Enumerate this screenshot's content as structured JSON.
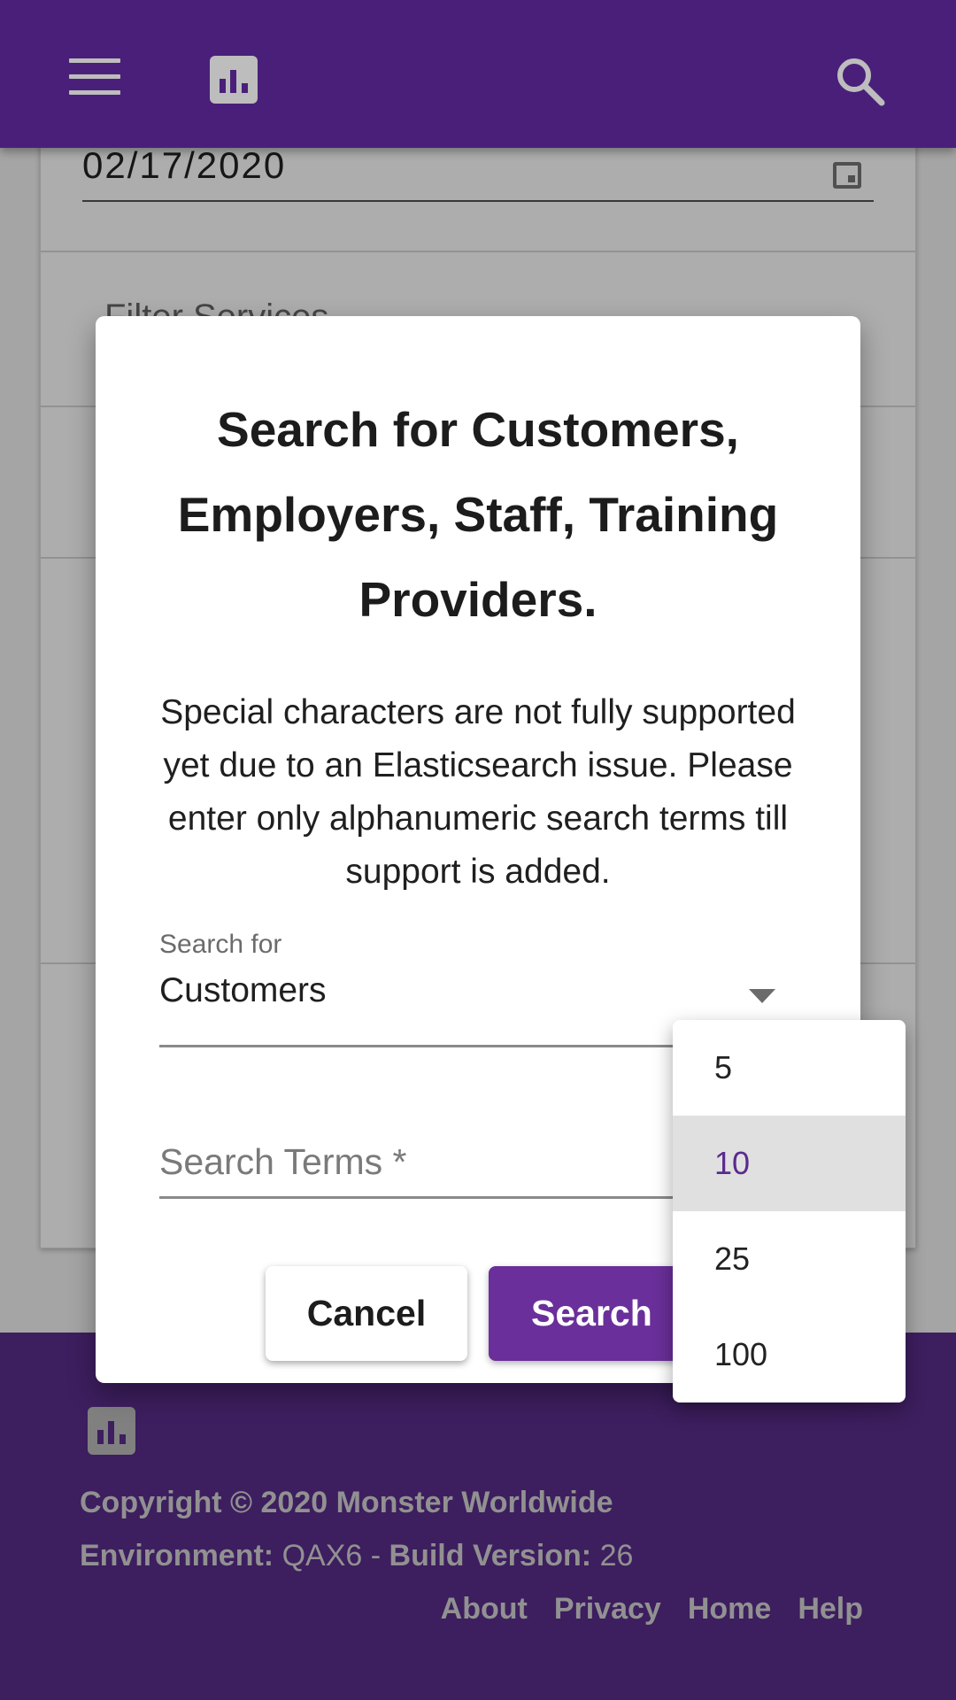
{
  "appbar": {
    "menu_icon": "hamburger-menu-icon",
    "logo_icon": "bar-chart-icon",
    "search_icon": "search-icon",
    "background_color": "#4a1f7a"
  },
  "page": {
    "date_value": "02/17/2020",
    "filter_label": "Filter Services"
  },
  "dialog": {
    "title": "Search for Customers, Employers, Staff, Training Providers.",
    "notice": "Special characters are not fully supported yet due to an Elasticsearch issue. Please enter only alphanumeric search terms till support is added.",
    "search_for_label": "Search for",
    "search_for_value": "Customers",
    "search_terms_placeholder": "Search Terms *",
    "search_terms_value": "",
    "cancel_label": "Cancel",
    "search_label": "Search",
    "primary_color": "#6a2f9a"
  },
  "dropdown": {
    "options": [
      "5",
      "10",
      "25",
      "100"
    ],
    "selected": "10"
  },
  "footer": {
    "copyright": "Copyright © 2020 Monster Worldwide",
    "environment_label": "Environment:",
    "environment_value": "QAX6",
    "separator": "-",
    "build_label": "Build Version:",
    "build_value": "26",
    "links": [
      "About",
      "Privacy",
      "Home",
      "Help"
    ],
    "background_color": "#5a2d8c"
  }
}
